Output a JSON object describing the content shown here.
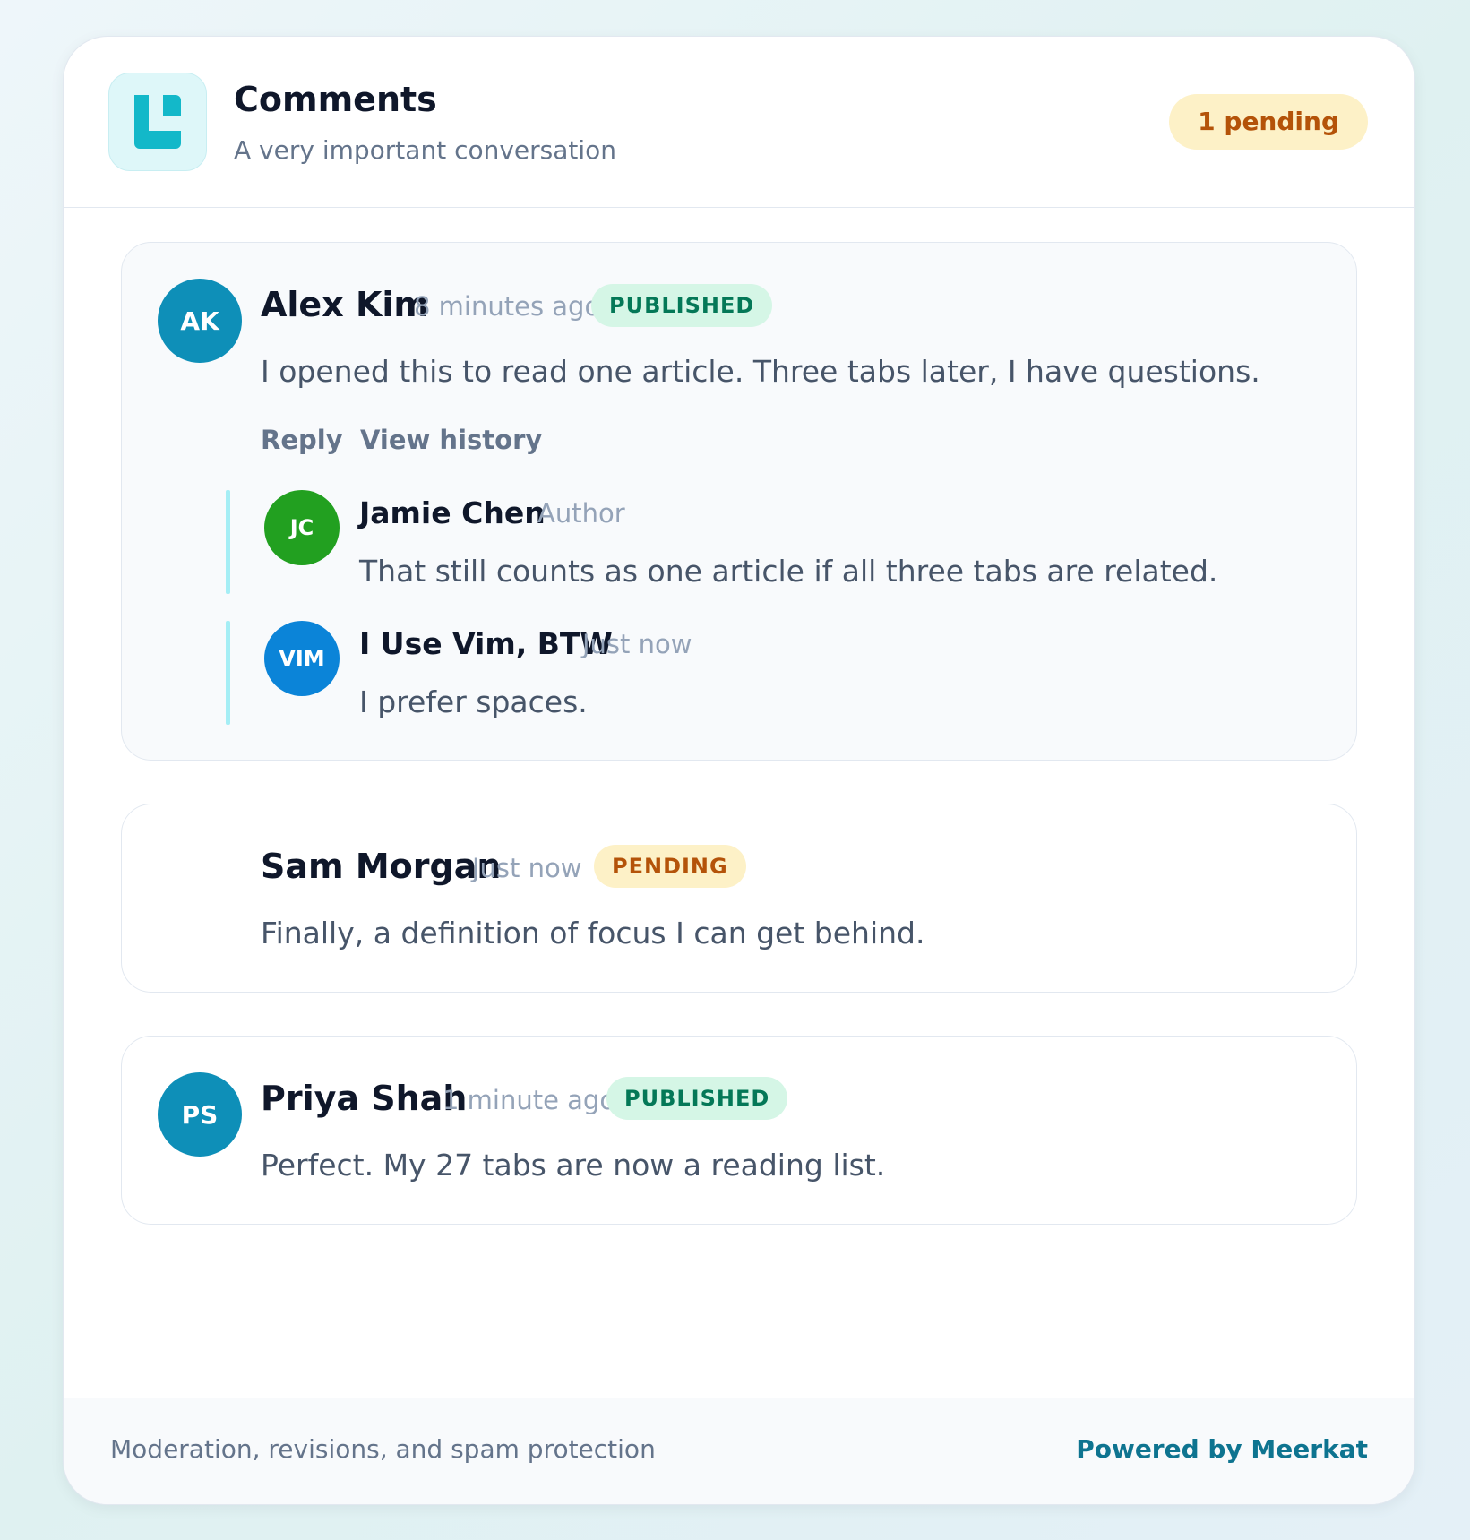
{
  "header": {
    "title": "Comments",
    "subtitle": "A very important conversation",
    "pending_label": "1 pending",
    "logo_icon": "layout-icon"
  },
  "comments": [
    {
      "author": "Alex Kim",
      "initials": "AK",
      "time": "8 minutes ago",
      "status": "PUBLISHED",
      "text": "I opened this to read one article. Three tabs later, I have questions.",
      "avatar_color": "#0e8fb8",
      "actions": [
        "Reply",
        "View history"
      ],
      "replies": [
        {
          "author": "Jamie Chen",
          "initials": "JC",
          "meta": "Author",
          "text": "That still counts as one article if all three tabs are related.",
          "avatar_color": "#22a020"
        },
        {
          "author": "I Use Vim, BTW",
          "initials": "VIM",
          "meta": "Just now",
          "text": "I prefer spaces.",
          "avatar_color": "#0b84d8"
        }
      ]
    },
    {
      "author": "Sam Morgan",
      "time": "Just now",
      "status": "PENDING",
      "text": "Finally, a definition of focus I can get behind."
    },
    {
      "author": "Priya Shah",
      "initials": "PS",
      "time": "1 minute ago",
      "status": "PUBLISHED",
      "text": "Perfect. My 27 tabs are now a reading list.",
      "avatar_color": "#0e8fb8"
    }
  ],
  "footer": {
    "left_text": "Moderation, revisions, and spam protection",
    "powered_by": "Powered by Meerkat"
  },
  "colors": {
    "accent": "#13b8c9",
    "link": "#0e7490",
    "published_bg": "#d5f6e6",
    "published_fg": "#047857",
    "pending_bg": "#fdf1c7",
    "pending_fg": "#b45309"
  }
}
